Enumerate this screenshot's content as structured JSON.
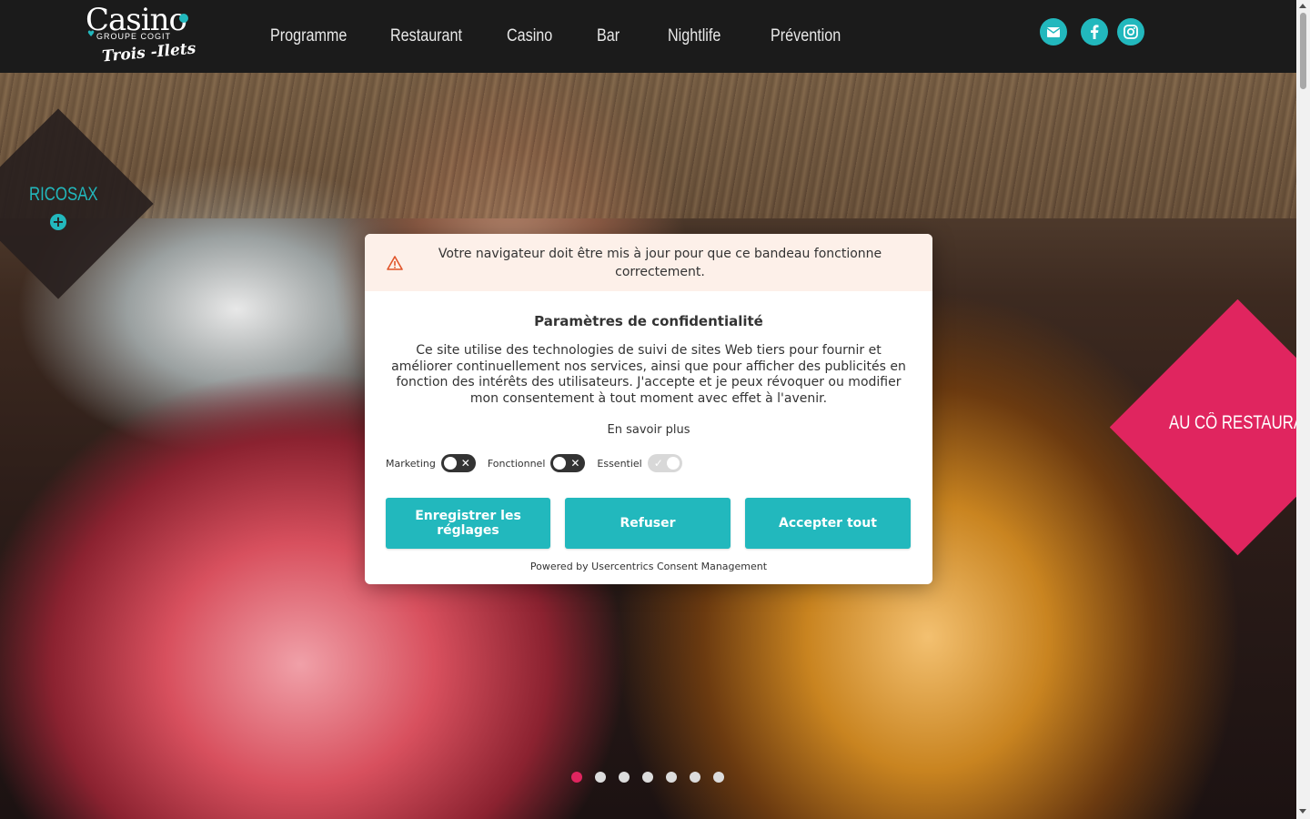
{
  "logo": {
    "brand": "Casino",
    "group": "GROUPE COGIT",
    "location": "Trois -Ilets"
  },
  "nav": {
    "items": [
      "Programme",
      "Restaurant",
      "Casino",
      "Bar",
      "Nightlife",
      "Prévention"
    ]
  },
  "social": {
    "icons": [
      "envelope-icon",
      "facebook-icon",
      "instagram-icon"
    ],
    "accent_color": "#22b8bd"
  },
  "hero": {
    "left_card_label": "RICOSAX",
    "right_card_label": "AU CÔ RESTAURAN",
    "right_card_color": "#e0255f",
    "slide_count": 7,
    "active_slide": 1
  },
  "consent": {
    "warning": "Votre navigateur doit être mis à jour pour que ce bandeau fonctionne correctement.",
    "title": "Paramètres de confidentialité",
    "description": "Ce site utilise des technologies de suivi de sites Web tiers pour fournir et améliorer continuellement nos services, ainsi que pour afficher des publicités en fonction des intérêts des utilisateurs. J'accepte et je peux révoquer ou modifier mon consentement à tout moment avec effet à l'avenir.",
    "learn_more": "En savoir plus",
    "toggles": [
      {
        "label": "Marketing",
        "state": "off"
      },
      {
        "label": "Fonctionnel",
        "state": "off"
      },
      {
        "label": "Essentiel",
        "state": "on-disabled"
      }
    ],
    "buttons": {
      "save": "Enregistrer les réglages",
      "refuse": "Refuser",
      "accept": "Accepter tout"
    },
    "powered_by": "Powered by Usercentrics Consent Management",
    "button_color": "#22b8bd"
  }
}
